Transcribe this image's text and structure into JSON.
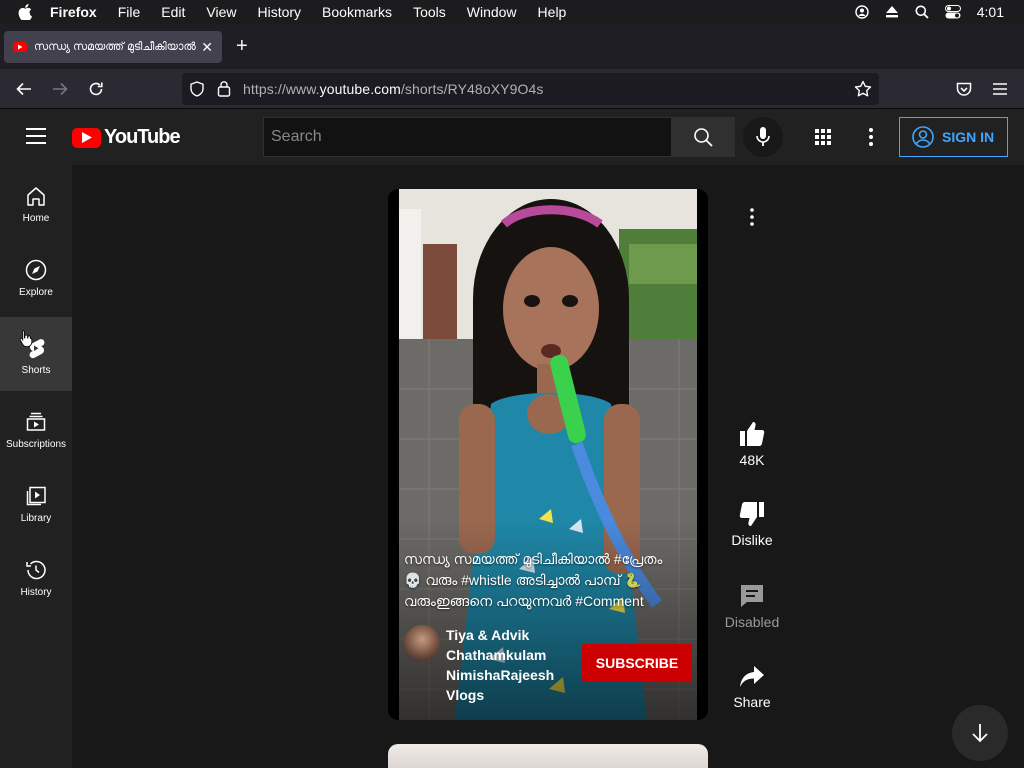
{
  "menubar": {
    "app": "Firefox",
    "items": [
      "File",
      "Edit",
      "View",
      "History",
      "Bookmarks",
      "Tools",
      "Window",
      "Help"
    ],
    "clock": "4:01"
  },
  "browser": {
    "tab_title": "സന്ധ്യ സമയത്ത് മുടിചീകിയാൽ #പ്രേതം",
    "url_prefix": "https://www.",
    "url_domain": "youtube.com",
    "url_path": "/shorts/RY48oXY9O4s"
  },
  "youtube": {
    "logo_text": "YouTube",
    "search_placeholder": "Search",
    "sign_in_label": "SIGN IN"
  },
  "rail": {
    "items": [
      {
        "label": "Home",
        "icon": "home-icon"
      },
      {
        "label": "Explore",
        "icon": "compass-icon"
      },
      {
        "label": "Shorts",
        "icon": "shorts-icon",
        "active": true
      },
      {
        "label": "Subscriptions",
        "icon": "subscriptions-icon"
      },
      {
        "label": "Library",
        "icon": "library-icon"
      },
      {
        "label": "History",
        "icon": "history-icon"
      }
    ]
  },
  "short": {
    "caption_line1": "സന്ധ്യ സമയത്ത് മുടിചീകിയാൽ #പ്രേതം",
    "caption_line2": "💀 വരും #whistle അടിച്ചാൽ പാമ്പ് 🐍",
    "caption_line3": "വരുംഇങ്ങനെ പറയുന്നവർ #Comment",
    "channel_name": "Tiya & Advik Chathamkulam NimishaRajeesh Vlogs",
    "subscribe_label": "SUBSCRIBE"
  },
  "actions": {
    "likes": "48K",
    "dislike_label": "Dislike",
    "comments_label": "Disabled",
    "share_label": "Share"
  }
}
